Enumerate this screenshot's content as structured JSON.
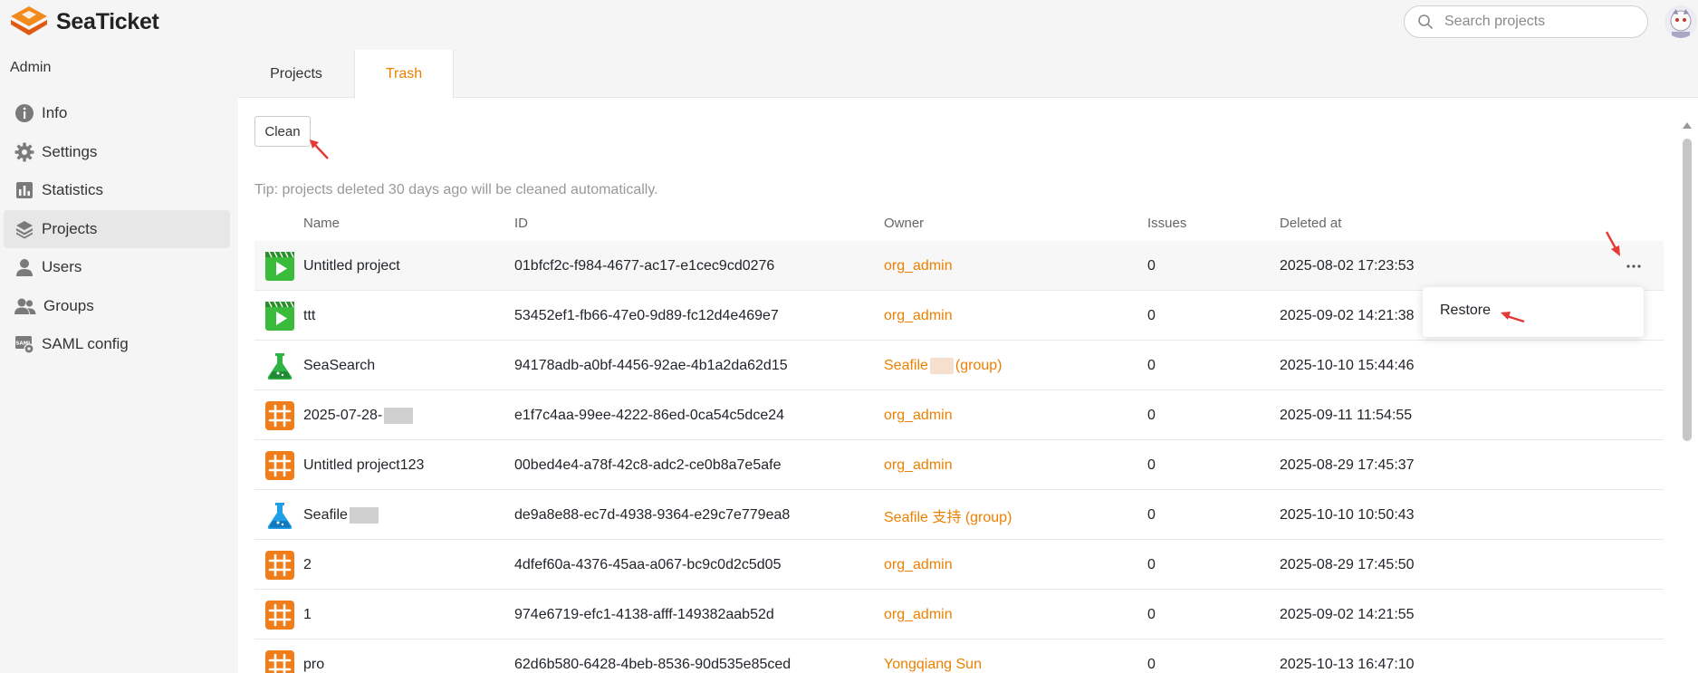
{
  "app": {
    "name": "SeaTicket",
    "accent_color": "#ec8000"
  },
  "search": {
    "placeholder": "Search projects",
    "icon": "search-icon"
  },
  "sidebar": {
    "heading": "Admin",
    "items": [
      {
        "label": "Info",
        "icon": "info-icon",
        "active": false
      },
      {
        "label": "Settings",
        "icon": "gear-icon",
        "active": false
      },
      {
        "label": "Statistics",
        "icon": "statistics-icon",
        "active": false
      },
      {
        "label": "Projects",
        "icon": "layers-icon",
        "active": true
      },
      {
        "label": "Users",
        "icon": "user-icon",
        "active": false
      },
      {
        "label": "Groups",
        "icon": "group-icon",
        "active": false
      },
      {
        "label": "SAML config",
        "icon": "saml-icon",
        "active": false
      }
    ]
  },
  "tabs": [
    {
      "label": "Projects",
      "active": false
    },
    {
      "label": "Trash",
      "active": true
    }
  ],
  "toolbar": {
    "clean_label": "Clean"
  },
  "tip": "Tip: projects deleted 30 days ago will be cleaned automatically.",
  "table": {
    "columns": [
      "Name",
      "ID",
      "Owner",
      "Issues",
      "Deleted at"
    ],
    "rows": [
      {
        "icon": "video-icon",
        "name": "Untitled project",
        "id": "01bfcf2c-f984-4677-ac17-e1cec9cd0276",
        "owner": "org_admin",
        "issues": "0",
        "deleted_at": "2025-08-02 17:23:53"
      },
      {
        "icon": "video-icon",
        "name": "ttt",
        "id": "53452ef1-fb66-47e0-9d89-fc12d4e469e7",
        "owner": "org_admin",
        "issues": "0",
        "deleted_at": "2025-09-02 14:21:38"
      },
      {
        "icon": "flask-green-icon",
        "name": "SeaSearch",
        "id": "94178adb-a0bf-4456-92ae-4b1a2da62d15",
        "owner_prefix": "Seafile ",
        "owner_suffix": "(group)",
        "issues": "0",
        "deleted_at": "2025-10-10 15:44:46"
      },
      {
        "icon": "grid-icon",
        "name": "2025-07-28-",
        "id": "e1f7c4aa-99ee-4222-86ed-0ca54c5dce24",
        "owner": "org_admin",
        "issues": "0",
        "deleted_at": "2025-09-11 11:54:55"
      },
      {
        "icon": "grid-icon",
        "name": "Untitled project123",
        "id": "00bed4e4-a78f-42c8-adc2-ce0b8a7e5afe",
        "owner": "org_admin",
        "issues": "0",
        "deleted_at": "2025-08-29 17:45:37"
      },
      {
        "icon": "flask-blue-icon",
        "name": "Seafile ",
        "id": "de9a8e88-ec7d-4938-9364-e29c7e779ea8",
        "owner": "Seafile 支持 (group)",
        "issues": "0",
        "deleted_at": "2025-10-10 10:50:43"
      },
      {
        "icon": "grid-icon",
        "name": "2",
        "id": "4dfef60a-4376-45aa-a067-bc9c0d2c5d05",
        "owner": "org_admin",
        "issues": "0",
        "deleted_at": "2025-08-29 17:45:50"
      },
      {
        "icon": "grid-icon",
        "name": "1",
        "id": "974e6719-efc1-4138-afff-149382aab52d",
        "owner": "org_admin",
        "issues": "0",
        "deleted_at": "2025-09-02 14:21:55"
      },
      {
        "icon": "grid-icon",
        "name": "pro",
        "id": "62d6b580-6428-4beb-8536-90d535e85ced",
        "owner": "Yongqiang Sun",
        "issues": "0",
        "deleted_at": "2025-10-13 16:47:10"
      }
    ]
  },
  "row_menu": {
    "more_icon": "more-icon",
    "items": [
      {
        "label": "Restore"
      }
    ]
  }
}
